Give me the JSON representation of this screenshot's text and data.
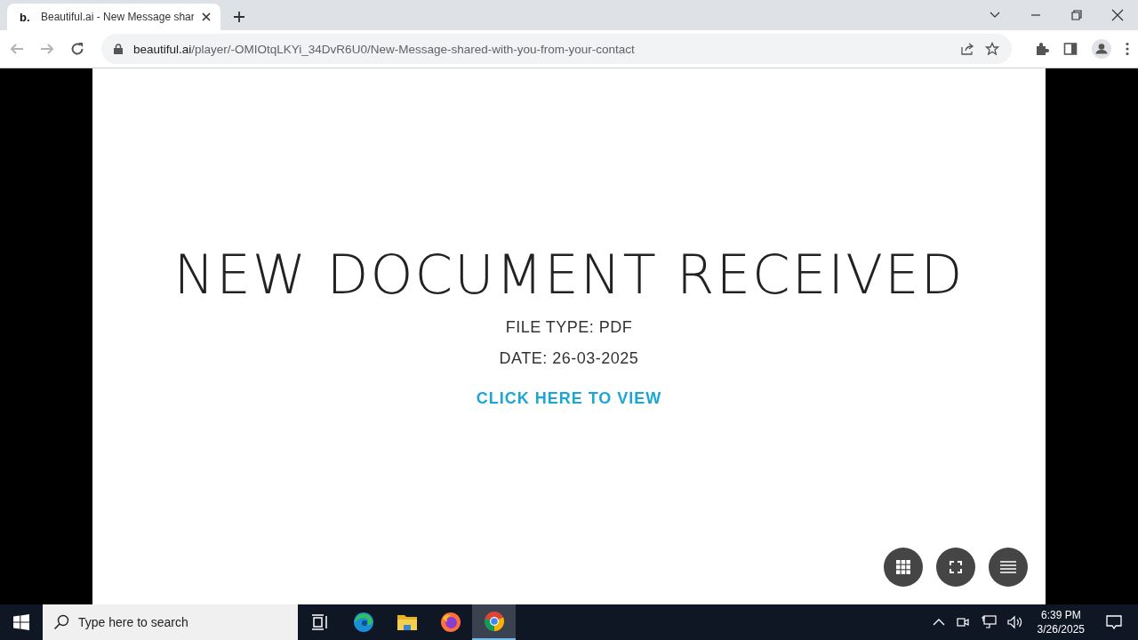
{
  "browser": {
    "tabs": [
      {
        "favicon": "b.",
        "title": "Beautiful.ai - New Message shar",
        "selected": true
      }
    ],
    "address": {
      "host": "beautiful.ai",
      "path": "/player/-OMIOtqLKYi_34DvR6U0/New-Message-shared-with-you-from-your-contact"
    }
  },
  "slide": {
    "title": "NEW DOCUMENT RECEIVED",
    "lines": [
      "FILE TYPE: PDF",
      "DATE: 26-03-2025"
    ],
    "link": "CLICK HERE TO VIEW"
  },
  "taskbar": {
    "search": {
      "placeholder": "Type here to search"
    },
    "apps": [
      {
        "kind": "taskview",
        "selected": false
      },
      {
        "kind": "edge",
        "selected": false
      },
      {
        "kind": "explorer",
        "selected": false
      },
      {
        "kind": "firefox",
        "selected": false
      },
      {
        "kind": "chrome",
        "selected": true
      }
    ],
    "time": "6:39 PM",
    "date": "3/26/2025"
  }
}
